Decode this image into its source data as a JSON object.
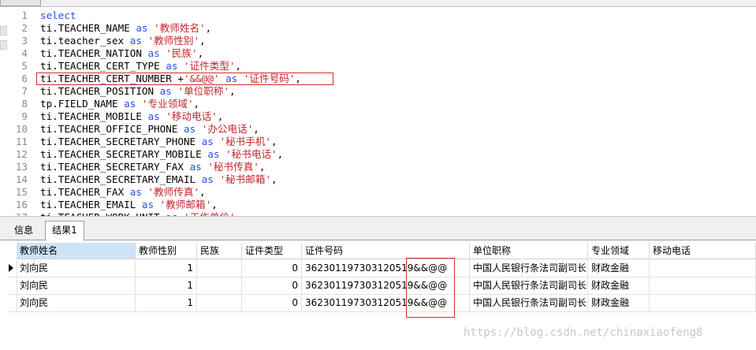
{
  "editor": {
    "lines": [
      {
        "n": "1",
        "parts": [
          {
            "t": "select",
            "c": "kw"
          }
        ]
      },
      {
        "n": "2",
        "parts": [
          {
            "t": "ti.TEACHER_NAME ",
            "c": "id"
          },
          {
            "t": "as",
            "c": "kw"
          },
          {
            "t": " ",
            "c": "id"
          },
          {
            "t": "'教师姓名'",
            "c": "str"
          },
          {
            "t": ",",
            "c": "id"
          }
        ]
      },
      {
        "n": "3",
        "parts": [
          {
            "t": "ti.teacher_sex ",
            "c": "id"
          },
          {
            "t": "as",
            "c": "kw"
          },
          {
            "t": " ",
            "c": "id"
          },
          {
            "t": "'教师性别'",
            "c": "str"
          },
          {
            "t": ",",
            "c": "id"
          }
        ]
      },
      {
        "n": "4",
        "parts": [
          {
            "t": "ti.TEACHER_NATION ",
            "c": "id"
          },
          {
            "t": "as",
            "c": "kw"
          },
          {
            "t": " ",
            "c": "id"
          },
          {
            "t": "'民族'",
            "c": "str"
          },
          {
            "t": ",",
            "c": "id"
          }
        ]
      },
      {
        "n": "5",
        "parts": [
          {
            "t": "ti.TEACHER_CERT_TYPE ",
            "c": "id"
          },
          {
            "t": "as",
            "c": "kw"
          },
          {
            "t": " ",
            "c": "id"
          },
          {
            "t": "'证件类型'",
            "c": "str"
          },
          {
            "t": ",",
            "c": "id"
          }
        ]
      },
      {
        "n": "6",
        "parts": [
          {
            "t": "ti.TEACHER_CERT_NUMBER +",
            "c": "id"
          },
          {
            "t": "'&&@@'",
            "c": "str"
          },
          {
            "t": " ",
            "c": "id"
          },
          {
            "t": "as",
            "c": "kw"
          },
          {
            "t": " ",
            "c": "id"
          },
          {
            "t": "'证件号码'",
            "c": "str"
          },
          {
            "t": ",",
            "c": "id"
          }
        ]
      },
      {
        "n": "7",
        "parts": [
          {
            "t": "ti.TEACHER_POSITION ",
            "c": "id"
          },
          {
            "t": "as",
            "c": "kw"
          },
          {
            "t": " ",
            "c": "id"
          },
          {
            "t": "'单位职称'",
            "c": "str"
          },
          {
            "t": ",",
            "c": "id"
          }
        ]
      },
      {
        "n": "8",
        "parts": [
          {
            "t": "tp.FIELD_NAME ",
            "c": "id"
          },
          {
            "t": "as",
            "c": "kw"
          },
          {
            "t": " ",
            "c": "id"
          },
          {
            "t": "'专业领域'",
            "c": "str"
          },
          {
            "t": ",",
            "c": "id"
          }
        ]
      },
      {
        "n": "9",
        "parts": [
          {
            "t": "ti.TEACHER_MOBILE ",
            "c": "id"
          },
          {
            "t": "as",
            "c": "kw"
          },
          {
            "t": " ",
            "c": "id"
          },
          {
            "t": "'移动电话'",
            "c": "str"
          },
          {
            "t": ",",
            "c": "id"
          }
        ]
      },
      {
        "n": "10",
        "parts": [
          {
            "t": "ti.TEACHER_OFFICE_PHONE ",
            "c": "id"
          },
          {
            "t": "as",
            "c": "kw"
          },
          {
            "t": " ",
            "c": "id"
          },
          {
            "t": "'办公电话'",
            "c": "str"
          },
          {
            "t": ",",
            "c": "id"
          }
        ]
      },
      {
        "n": "11",
        "parts": [
          {
            "t": "ti.TEACHER_SECRETARY_PHONE ",
            "c": "id"
          },
          {
            "t": "as",
            "c": "kw"
          },
          {
            "t": " ",
            "c": "id"
          },
          {
            "t": "'秘书手机'",
            "c": "str"
          },
          {
            "t": ",",
            "c": "id"
          }
        ]
      },
      {
        "n": "12",
        "parts": [
          {
            "t": "ti.TEACHER_SECRETARY_MOBILE ",
            "c": "id"
          },
          {
            "t": "as",
            "c": "kw"
          },
          {
            "t": " ",
            "c": "id"
          },
          {
            "t": "'秘书电话'",
            "c": "str"
          },
          {
            "t": ",",
            "c": "id"
          }
        ]
      },
      {
        "n": "13",
        "parts": [
          {
            "t": "ti.TEACHER_SECRETARY_FAX ",
            "c": "id"
          },
          {
            "t": "as",
            "c": "kw"
          },
          {
            "t": " ",
            "c": "id"
          },
          {
            "t": "'秘书传真'",
            "c": "str"
          },
          {
            "t": ",",
            "c": "id"
          }
        ]
      },
      {
        "n": "14",
        "parts": [
          {
            "t": "ti.TEACHER_SECRETARY_EMAIL ",
            "c": "id"
          },
          {
            "t": "as",
            "c": "kw"
          },
          {
            "t": " ",
            "c": "id"
          },
          {
            "t": "'秘书邮箱'",
            "c": "str"
          },
          {
            "t": ",",
            "c": "id"
          }
        ]
      },
      {
        "n": "15",
        "parts": [
          {
            "t": "ti.TEACHER_FAX ",
            "c": "id"
          },
          {
            "t": "as",
            "c": "kw"
          },
          {
            "t": " ",
            "c": "id"
          },
          {
            "t": "'教师传真'",
            "c": "str"
          },
          {
            "t": ",",
            "c": "id"
          }
        ]
      },
      {
        "n": "16",
        "parts": [
          {
            "t": "ti.TEACHER_EMAIL ",
            "c": "id"
          },
          {
            "t": "as",
            "c": "kw"
          },
          {
            "t": " ",
            "c": "id"
          },
          {
            "t": "'教师邮箱'",
            "c": "str"
          },
          {
            "t": ",",
            "c": "id"
          }
        ]
      },
      {
        "n": "17",
        "parts": [
          {
            "t": "ti.TEACHER_WORK_UNIT ",
            "c": "id"
          },
          {
            "t": "as",
            "c": "kw"
          },
          {
            "t": " ",
            "c": "id"
          },
          {
            "t": "'工作单位'",
            "c": "str"
          },
          {
            "t": ",",
            "c": "id"
          }
        ]
      }
    ]
  },
  "tabs": {
    "info_label": "信息",
    "result_label": "结果1"
  },
  "grid": {
    "columns": [
      "教师姓名",
      "教师性别",
      "民族",
      "证件类型",
      "证件号码",
      "单位职称",
      "专业领域",
      "移动电话"
    ],
    "rows": [
      [
        "刘向民",
        "1",
        "",
        "0",
        "362301197303120519&&@@",
        "中国人民银行条法司副司长",
        "财政金融",
        ""
      ],
      [
        "刘向民",
        "1",
        "",
        "0",
        "362301197303120519&&@@",
        "中国人民银行条法司副司长",
        "财政金融",
        ""
      ],
      [
        "刘向民",
        "1",
        "",
        "0",
        "362301197303120519&&@@",
        "中国人民银行条法司副司长",
        "财政金融",
        ""
      ]
    ]
  },
  "watermark": "https://blog.csdn.net/chinaxiaofeng8",
  "colors": {
    "keyword": "#2a50e6",
    "string": "#c0262d",
    "annotation": "#d42d2d",
    "selected_header": "#cfe3f6"
  }
}
